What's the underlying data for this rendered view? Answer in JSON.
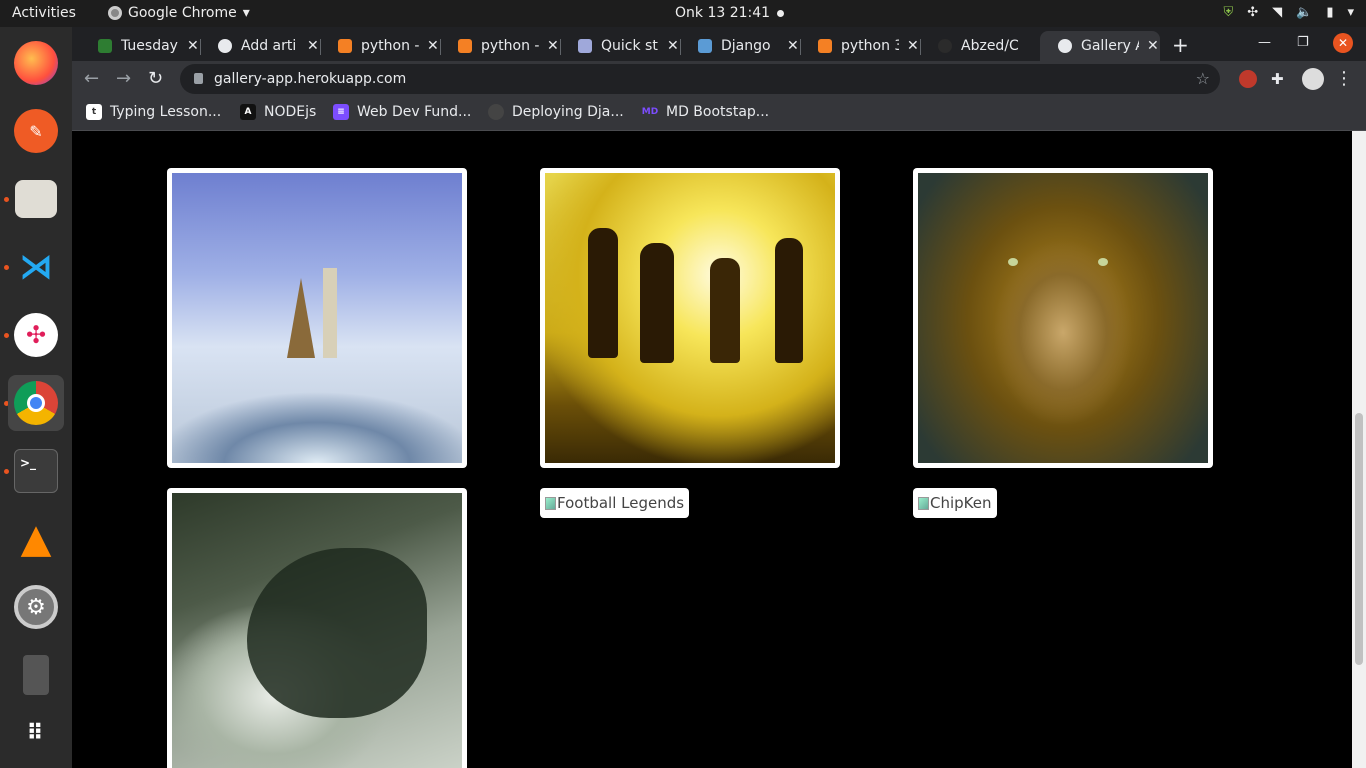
{
  "system": {
    "activities": "Activities",
    "app_name": "Google Chrome",
    "clock": "Onk 13  21:41"
  },
  "browser": {
    "tabs": [
      {
        "title": "Tuesday",
        "active": false
      },
      {
        "title": "Add arti",
        "active": false
      },
      {
        "title": "python -",
        "active": false
      },
      {
        "title": "python -",
        "active": false
      },
      {
        "title": "Quick st",
        "active": false
      },
      {
        "title": "Django",
        "active": false
      },
      {
        "title": "python 3",
        "active": false
      },
      {
        "title": "Abzed/C",
        "active": false
      },
      {
        "title": "Gallery A",
        "active": true
      }
    ],
    "url": "gallery-app.herokuapp.com",
    "bookmarks": [
      {
        "label": "Typing Lesson..."
      },
      {
        "label": "NODEjs"
      },
      {
        "label": "Web Dev Fund..."
      },
      {
        "label": "Deploying Dja..."
      },
      {
        "label": "MD Bootstap..."
      }
    ]
  },
  "gallery": {
    "images": [
      {
        "subject": "world landmarks on globe",
        "loaded": true
      },
      {
        "subject": "silhouettes dancing in water at sunset",
        "loaded": true
      },
      {
        "subject": "lion portrait",
        "loaded": true
      },
      {
        "subject": "dragon",
        "loaded": true
      }
    ],
    "broken_images": [
      {
        "alt": "Football Legends"
      },
      {
        "alt": "ChipKen"
      }
    ]
  },
  "colors": {
    "accent": "#e95420",
    "page_background": "#000000",
    "tabstrip": "#202124",
    "toolbar": "#35363a"
  }
}
